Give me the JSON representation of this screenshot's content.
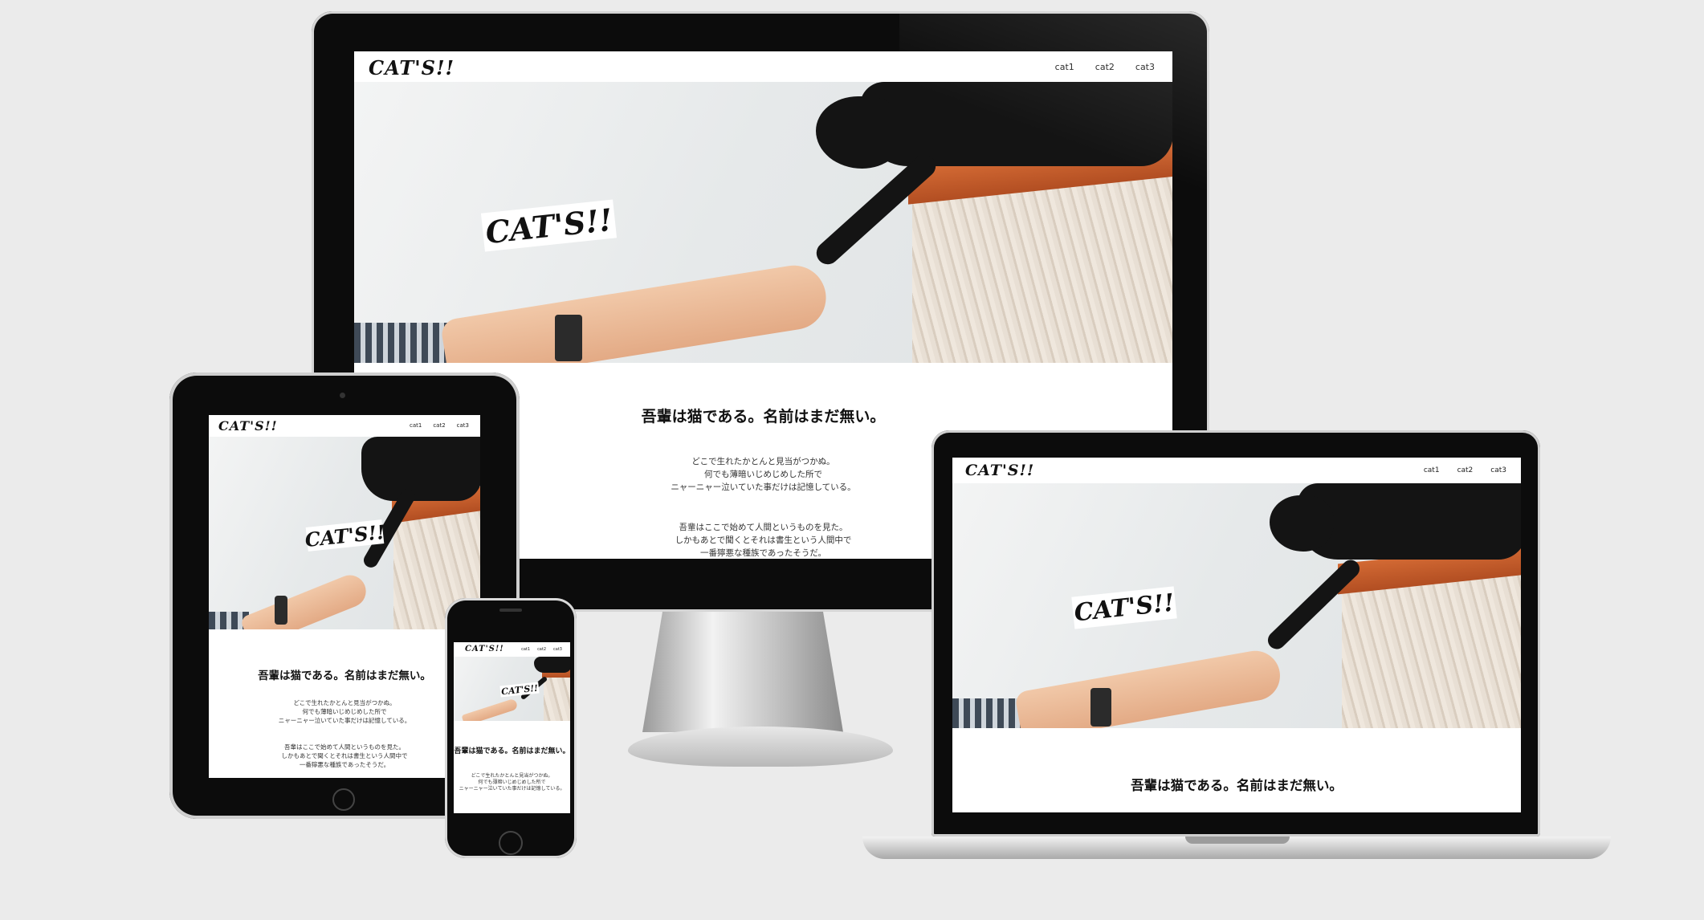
{
  "site": {
    "logo": "CAT'S!!",
    "nav": [
      "cat1",
      "cat2",
      "cat3"
    ],
    "heading": "吾輩は猫である。名前はまだ無い。",
    "para1": [
      "どこで生れたかとんと見当がつかぬ。",
      "何でも薄暗いじめじめした所で",
      "ニャーニャー泣いていた事だけは記憶している。"
    ],
    "para2": [
      "吾輩はここで始めて人間というものを見た。",
      "しかもあとで聞くとそれは書生という人間中で",
      "一番獰悪な種族であったそうだ。"
    ]
  }
}
